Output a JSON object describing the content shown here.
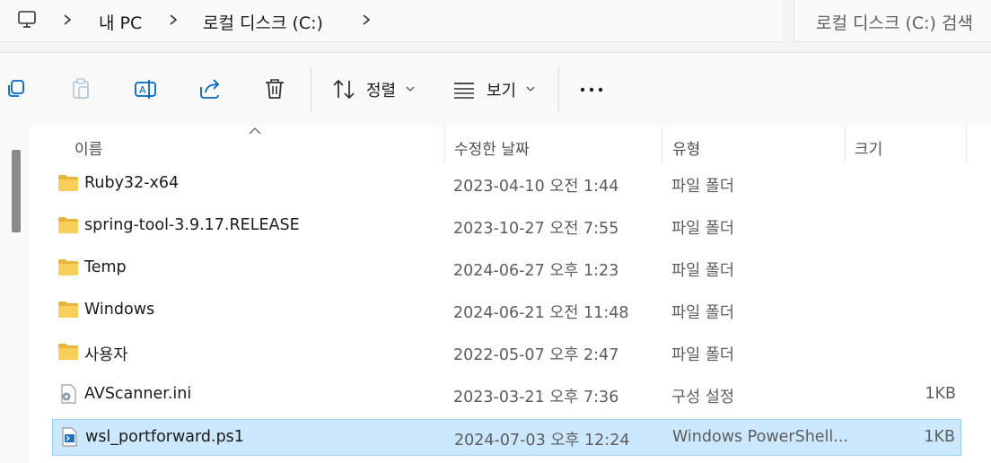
{
  "address_bar": {
    "crumbs": [
      "내 PC",
      "로컬 디스크 (C:)"
    ]
  },
  "search": {
    "placeholder": "로컬 디스크 (C:) 검색"
  },
  "toolbar": {
    "sort_label": "정렬",
    "view_label": "보기"
  },
  "columns": {
    "name": "이름",
    "date": "수정한 날짜",
    "type": "유형",
    "size": "크기"
  },
  "files": [
    {
      "name": "Ruby32-x64",
      "date": "2023-04-10 오전 1:44",
      "type": "파일 폴더",
      "size": "",
      "icon": "folder-icon"
    },
    {
      "name": "spring-tool-3.9.17.RELEASE",
      "date": "2023-10-27 오전 7:55",
      "type": "파일 폴더",
      "size": "",
      "icon": "folder-icon"
    },
    {
      "name": "Temp",
      "date": "2024-06-27 오후 1:23",
      "type": "파일 폴더",
      "size": "",
      "icon": "folder-icon"
    },
    {
      "name": "Windows",
      "date": "2024-06-21 오전 11:48",
      "type": "파일 폴더",
      "size": "",
      "icon": "folder-icon"
    },
    {
      "name": "사용자",
      "date": "2022-05-07 오후 2:47",
      "type": "파일 폴더",
      "size": "",
      "icon": "folder-icon"
    },
    {
      "name": "AVScanner.ini",
      "date": "2023-03-21 오후 7:36",
      "type": "구성 설정",
      "size": "1KB",
      "icon": "settings-file-icon"
    },
    {
      "name": "wsl_portforward.ps1",
      "date": "2024-07-03 오후 12:24",
      "type": "Windows PowerShell...",
      "size": "1KB",
      "icon": "powershell-file-icon",
      "selected": true
    }
  ],
  "colors": {
    "selection": "#cce8ff",
    "folder": "#f5c84c"
  }
}
